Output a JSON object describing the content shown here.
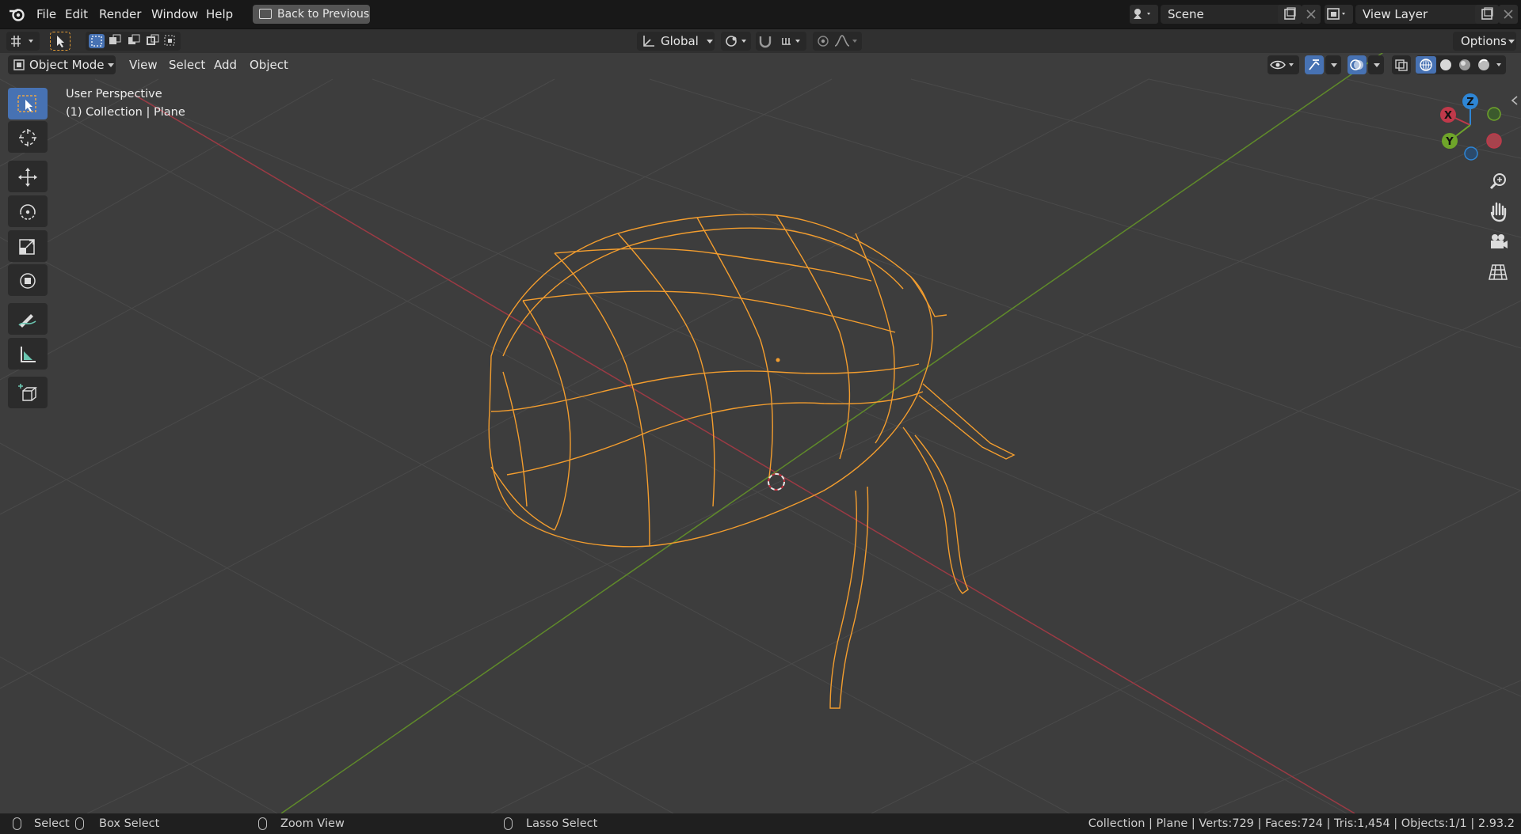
{
  "menu": {
    "file": "File",
    "edit": "Edit",
    "render": "Render",
    "window": "Window",
    "help": "Help",
    "back_button": "Back to Previous"
  },
  "scene": {
    "value": "Scene"
  },
  "view_layer": {
    "value": "View Layer"
  },
  "tool_header": {
    "orientation": "Global",
    "options": "Options"
  },
  "view_header": {
    "mode": "Object Mode",
    "view": "View",
    "select": "Select",
    "add": "Add",
    "object": "Object"
  },
  "viewport": {
    "perspective": "User Perspective",
    "collection_info": "(1) Collection | Plane"
  },
  "gizmo": {
    "x": "X",
    "y": "Y",
    "z": "Z"
  },
  "status": {
    "select": "Select",
    "box_select": "Box Select",
    "zoom_view": "Zoom View",
    "lasso_select": "Lasso Select",
    "stats": "Collection | Plane | Verts:729 | Faces:724 | Tris:1,454 | Objects:1/1 | 2.93.2"
  },
  "colors": {
    "selected_wire": "#f39d2e",
    "x_axis": "#a8434d",
    "y_axis": "#6e9a2e",
    "active_tool": "#4772b3"
  }
}
